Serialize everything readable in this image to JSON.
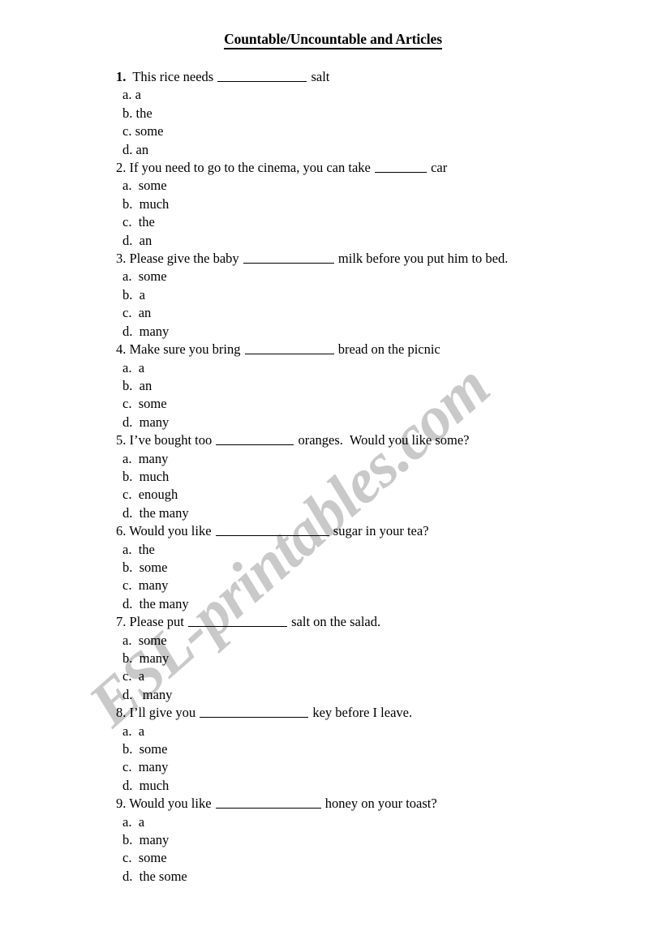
{
  "document": {
    "title": "Countable/Uncountable and Articles",
    "watermark": "ESL-printables.com"
  },
  "questions": [
    {
      "number": "1.",
      "number_bold": true,
      "text_before": "  This rice needs ",
      "blank_width": 110,
      "text_after": " salt",
      "option_gap": " ",
      "options": [
        {
          "letter": "a.",
          "text": "a"
        },
        {
          "letter": "b.",
          "text": "the"
        },
        {
          "letter": "c.",
          "text": "some"
        },
        {
          "letter": "d.",
          "text": "an"
        }
      ]
    },
    {
      "number": "2.",
      "number_bold": false,
      "text_before": " If you need to go to the cinema, you can take ",
      "blank_width": 64,
      "text_after": " car",
      "option_gap": "  ",
      "options": [
        {
          "letter": "a.",
          "text": "some"
        },
        {
          "letter": "b.",
          "text": "much"
        },
        {
          "letter": "c.",
          "text": "the"
        },
        {
          "letter": "d.",
          "text": "an"
        }
      ]
    },
    {
      "number": "3.",
      "number_bold": false,
      "text_before": " Please give the baby ",
      "blank_width": 112,
      "text_after": " milk before you put him to bed.",
      "option_gap": "  ",
      "options": [
        {
          "letter": "a.",
          "text": "some"
        },
        {
          "letter": "b.",
          "text": "a"
        },
        {
          "letter": "c.",
          "text": "an"
        },
        {
          "letter": "d.",
          "text": "many"
        }
      ]
    },
    {
      "number": "4.",
      "number_bold": false,
      "text_before": " Make sure you bring ",
      "blank_width": 110,
      "text_after": " bread on the picnic",
      "option_gap": "  ",
      "options": [
        {
          "letter": "a.",
          "text": "a"
        },
        {
          "letter": "b.",
          "text": "an"
        },
        {
          "letter": "c.",
          "text": "some"
        },
        {
          "letter": "d.",
          "text": "many"
        }
      ]
    },
    {
      "number": "5.",
      "number_bold": false,
      "text_before": " I’ve bought too ",
      "blank_width": 96,
      "text_after": " oranges.  Would you like some?",
      "option_gap": "  ",
      "options": [
        {
          "letter": "a.",
          "text": "many"
        },
        {
          "letter": "b.",
          "text": "much"
        },
        {
          "letter": "c.",
          "text": "enough"
        },
        {
          "letter": "d.",
          "text": "the many"
        }
      ]
    },
    {
      "number": "6.",
      "number_bold": false,
      "text_before": " Would you like ",
      "blank_width": 140,
      "text_after": " sugar in your tea?",
      "option_gap": "  ",
      "options": [
        {
          "letter": "a.",
          "text": "the"
        },
        {
          "letter": "b.",
          "text": "some"
        },
        {
          "letter": "c.",
          "text": "many"
        },
        {
          "letter": "d.",
          "text": "the many"
        }
      ]
    },
    {
      "number": "7.",
      "number_bold": false,
      "text_before": " Please put ",
      "blank_width": 122,
      "text_after": " salt on the salad.",
      "option_gap": "  ",
      "options": [
        {
          "letter": "a.",
          "text": "some"
        },
        {
          "letter": "b.",
          "text": "many"
        },
        {
          "letter": "c.",
          "text": "a"
        },
        {
          "letter": "d.",
          "text": " many"
        }
      ]
    },
    {
      "number": "8.",
      "number_bold": false,
      "text_before": " I’ll give you ",
      "blank_width": 134,
      "text_after": " key before I leave.",
      "option_gap": "  ",
      "options": [
        {
          "letter": "a.",
          "text": "a"
        },
        {
          "letter": "b.",
          "text": "some"
        },
        {
          "letter": "c.",
          "text": "many"
        },
        {
          "letter": "d.",
          "text": "much"
        }
      ]
    },
    {
      "number": "9.",
      "number_bold": false,
      "text_before": " Would you like ",
      "blank_width": 130,
      "text_after": " honey on your toast?",
      "option_gap": "  ",
      "options": [
        {
          "letter": "a.",
          "text": "a"
        },
        {
          "letter": "b.",
          "text": "many"
        },
        {
          "letter": "c.",
          "text": "some"
        },
        {
          "letter": "d.",
          "text": "the some"
        }
      ]
    }
  ]
}
